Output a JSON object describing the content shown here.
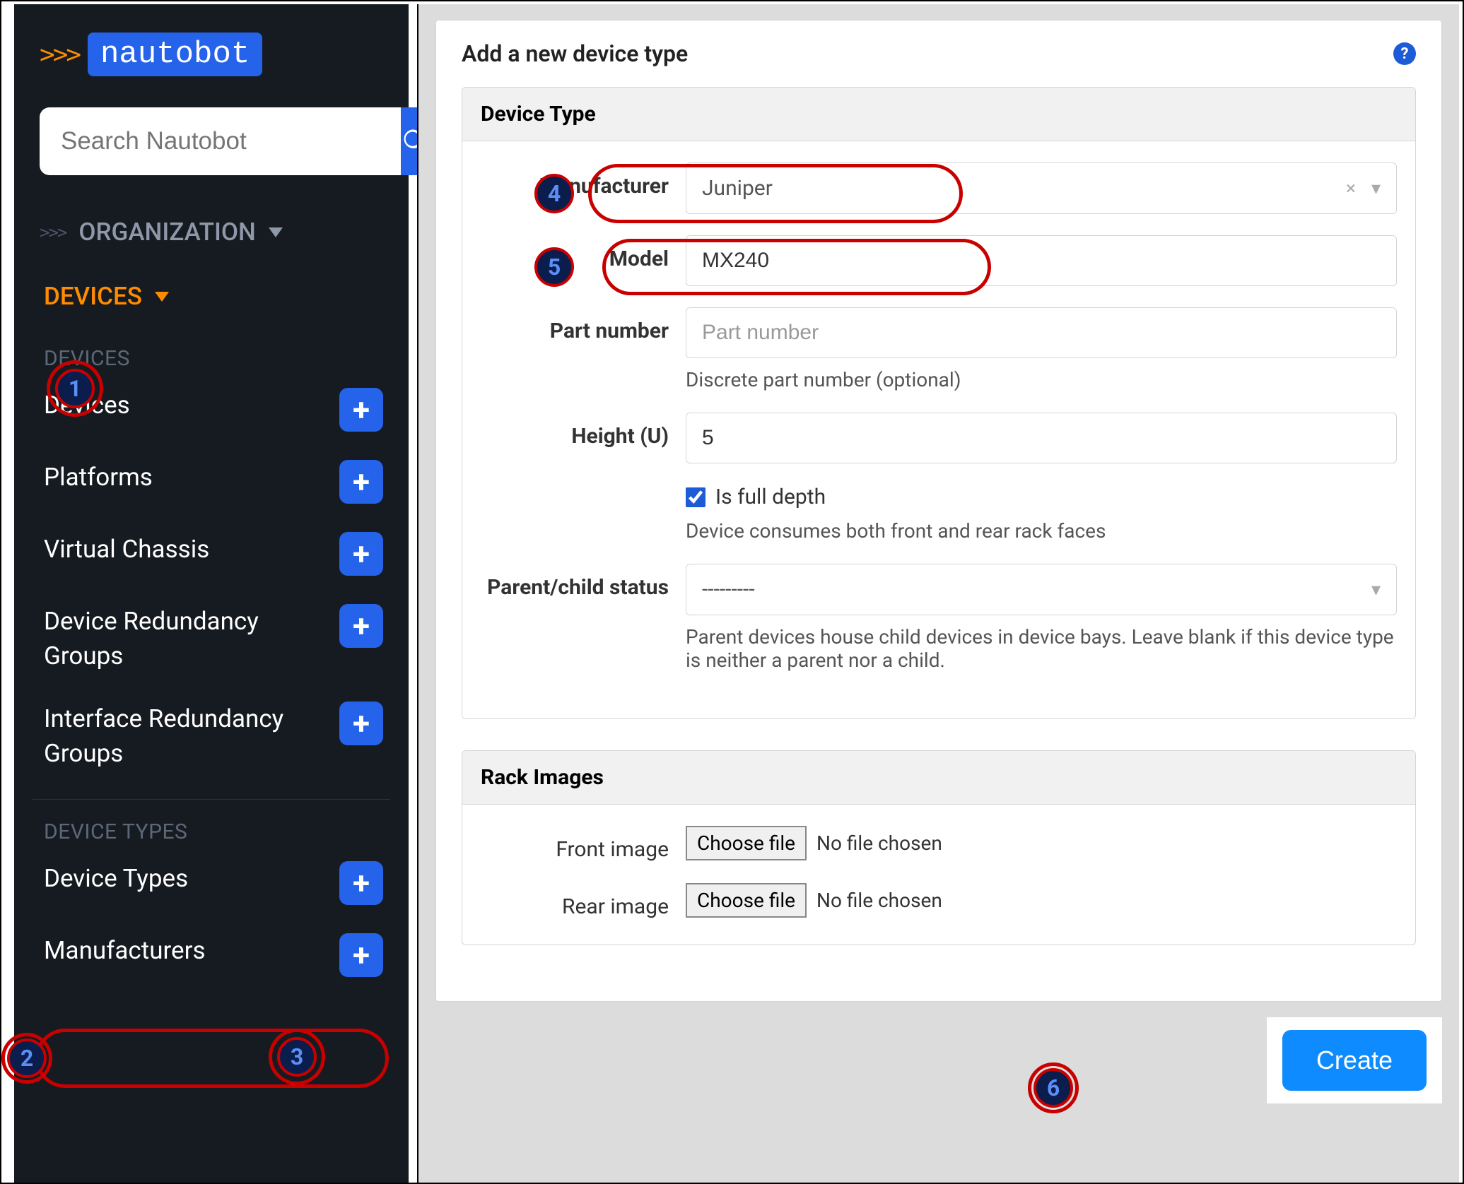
{
  "logo": {
    "text": "nautobot"
  },
  "search": {
    "placeholder": "Search Nautobot"
  },
  "nav_sections": {
    "organization": "ORGANIZATION",
    "devices": "DEVICES"
  },
  "sidebar": {
    "heading_devices": "DEVICES",
    "items": [
      {
        "label": "Devices"
      },
      {
        "label": "Platforms"
      },
      {
        "label": "Virtual Chassis"
      },
      {
        "label": "Device Redundancy Groups"
      },
      {
        "label": "Interface Redundancy Groups"
      }
    ],
    "heading_device_types": "DEVICE TYPES",
    "types_items": [
      {
        "label": "Device Types"
      },
      {
        "label": "Manufacturers"
      }
    ]
  },
  "form": {
    "title": "Add a new device type",
    "panel1_title": "Device Type",
    "manufacturer_label": "Manufacturer",
    "manufacturer_value": "Juniper",
    "model_label": "Model",
    "model_value": "MX240",
    "part_label": "Part number",
    "part_placeholder": "Part number",
    "part_help": "Discrete part number (optional)",
    "height_label": "Height (U)",
    "height_value": "5",
    "full_depth_label": "Is full depth",
    "full_depth_help": "Device consumes both front and rear rack faces",
    "parent_label": "Parent/child status",
    "parent_value": "---------",
    "parent_help": "Parent devices house child devices in device bays. Leave blank if this device type is neither a parent nor a child.",
    "panel2_title": "Rack Images",
    "front_label": "Front image",
    "rear_label": "Rear image",
    "choose_file": "Choose file",
    "no_file": "No file chosen",
    "create_label": "Create"
  },
  "callouts": {
    "c1": "1",
    "c2": "2",
    "c3": "3",
    "c4": "4",
    "c5": "5",
    "c6": "6"
  }
}
